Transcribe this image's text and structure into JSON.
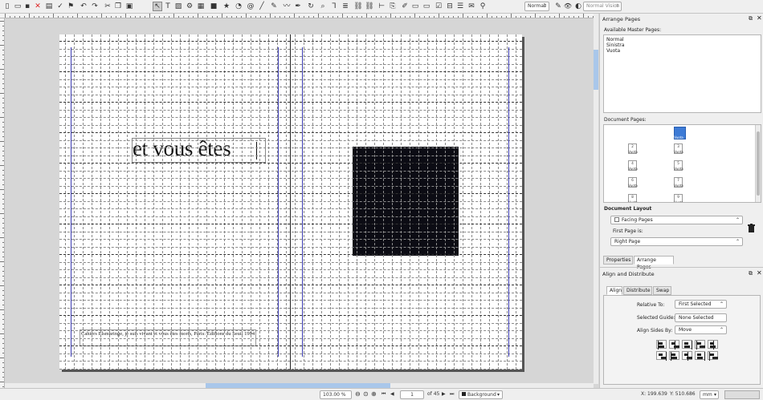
{
  "toolbar": {
    "icons": [
      "new-icon",
      "open-icon",
      "save-icon",
      "close-icon",
      "print-icon",
      "preflight-icon",
      "pdf-icon",
      "undo-icon",
      "redo-icon",
      "cut-icon",
      "copy-icon",
      "paste-icon",
      "select-icon",
      "text-frame-icon",
      "image-frame-icon",
      "render-frame-icon",
      "table-icon",
      "shape-icon",
      "polygon-icon",
      "arc-icon",
      "spiral-icon",
      "line-icon",
      "bezier-icon",
      "freehand-icon",
      "calligraphic-icon",
      "rotate-icon",
      "zoom-icon",
      "edit-text-icon",
      "story-editor-icon",
      "link-frames-icon",
      "unlink-frames-icon",
      "measure-icon",
      "copy-properties-icon",
      "eyedropper-icon",
      "pdf-push-button-icon",
      "pdf-text-field-icon",
      "pdf-checkbox-icon",
      "pdf-combo-box-icon",
      "pdf-list-box-icon",
      "pdf-text-annotation-icon",
      "pdf-link-annotation-icon"
    ],
    "image_preview_quality": "Normal",
    "visual_appearance": "Normal Vision",
    "preview_mode_icon": "eye-icon",
    "edit_mode_icon": "pencil-icon"
  },
  "document": {
    "headline": "et vous êtes",
    "caption": "Cahiers Elsmaringe, je suis vivant et vous êtes morts, Paris: Éditions du Seuil 1994",
    "shape_color": "#0c0c14"
  },
  "statusbar": {
    "zoom": "103.00 %",
    "current_page": "1",
    "page_of": "of 45",
    "layer": "Background",
    "x_coord": "X: 199.639",
    "y_coord": "Y: 510.686",
    "unit": "mm"
  },
  "arrange_pages": {
    "title": "Arrange Pages",
    "available_master_pages_label": "Available Master Pages:",
    "master_pages": [
      "Normal",
      "Sinistra",
      "Vuota"
    ],
    "document_pages_label": "Document Pages:",
    "pages": [
      {
        "num": "",
        "master": "Vuota",
        "side": "right",
        "selected": true
      },
      {
        "num": "2",
        "master": "Vuota",
        "side": "left"
      },
      {
        "num": "3",
        "master": "Vuota",
        "side": "right"
      },
      {
        "num": "4",
        "master": "Vuota",
        "side": "left"
      },
      {
        "num": "5",
        "master": "Vuota",
        "side": "right"
      },
      {
        "num": "6",
        "master": "Vuota",
        "side": "left"
      },
      {
        "num": "7",
        "master": "Vuota",
        "side": "right"
      },
      {
        "num": "8",
        "master": "Vuota",
        "side": "left"
      },
      {
        "num": "9",
        "master": "Vuota",
        "side": "right"
      }
    ],
    "document_layout_label": "Document Layout",
    "layout_value": "Facing Pages",
    "first_page_label": "First Page is:",
    "first_page_value": "Right Page",
    "delete_icon": "trash-icon"
  },
  "panel_tabs": [
    "Properties",
    "Arrange Pages"
  ],
  "align_distribute": {
    "title": "Align and Distribute",
    "tabs": [
      "Align",
      "Distribute",
      "Swap"
    ],
    "relative_to_label": "Relative To:",
    "relative_to_value": "First Selected",
    "selected_guide_label": "Selected Guide:",
    "selected_guide_value": "None Selected",
    "align_sides_label": "Align Sides By:",
    "align_sides_value": "Move"
  }
}
